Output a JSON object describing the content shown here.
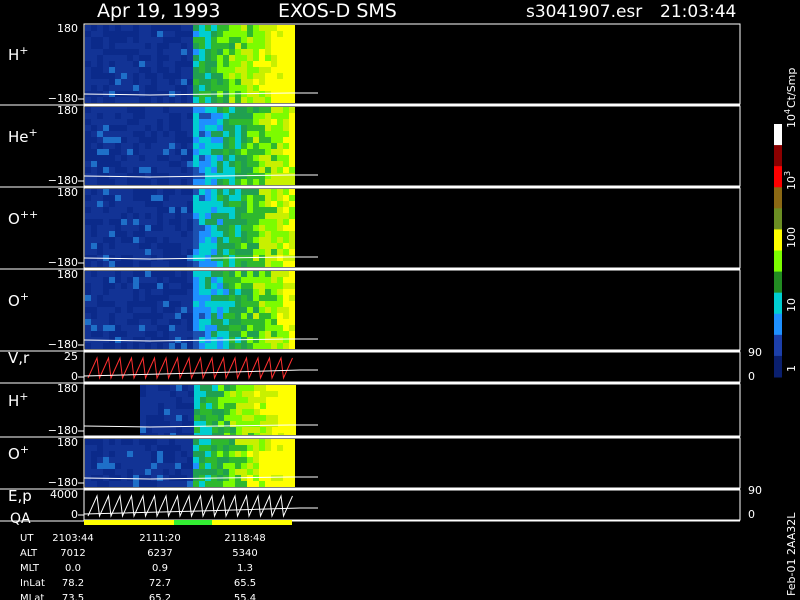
{
  "header": {
    "date": "Apr 19, 1993",
    "instrument": "EXOS-D SMS",
    "file": "s3041907.esr",
    "time": "21:03:44"
  },
  "panels": [
    {
      "id": "h-plus-1",
      "label": "H",
      "sup": "+",
      "ytop": "180",
      "ybot": "−180"
    },
    {
      "id": "he-plus",
      "label": "He",
      "sup": "+",
      "ytop": "180",
      "ybot": "−180"
    },
    {
      "id": "o-plus-plus",
      "label": "O",
      "sup": "++",
      "ytop": "180",
      "ybot": "−180"
    },
    {
      "id": "o-plus-1",
      "label": "O",
      "sup": "+",
      "ytop": "180",
      "ybot": "−180"
    },
    {
      "id": "v-r",
      "label": "V,r",
      "sup": "",
      "ytop": "25",
      "ybot": "0",
      "right_top": "90",
      "right_bot": "0"
    },
    {
      "id": "h-plus-2",
      "label": "H",
      "sup": "+",
      "ytop": "180",
      "ybot": "−180"
    },
    {
      "id": "o-plus-2",
      "label": "O",
      "sup": "+",
      "ytop": "180",
      "ybot": "−180"
    },
    {
      "id": "e-p",
      "label": "E,p",
      "sup": "",
      "ytop": "4000",
      "ybot": "0",
      "right_top": "90",
      "right_bot": "0"
    }
  ],
  "qa_label": "QA",
  "colorbar": {
    "unit": "Ct/Smp",
    "labels": [
      {
        "base": "10",
        "exp": "4"
      },
      {
        "base": "10",
        "exp": "3"
      },
      {
        "base": "100",
        "exp": ""
      },
      {
        "base": "10",
        "exp": ""
      },
      {
        "base": "1",
        "exp": ""
      }
    ],
    "colors": [
      "#ffffff",
      "#8b0000",
      "#ff0000",
      "#8b6914",
      "#6b8e23",
      "#ffff00",
      "#7cfc00",
      "#228b22",
      "#00ced1",
      "#1e90ff",
      "#1c3faa",
      "#0a1f6e"
    ]
  },
  "footer": {
    "rows": [
      {
        "label": "UT",
        "values": [
          "2103:44",
          "2111:20",
          "2118:48"
        ]
      },
      {
        "label": "ALT",
        "values": [
          "7012",
          "6237",
          "5340"
        ]
      },
      {
        "label": "MLT",
        "values": [
          "0.0",
          "0.9",
          "1.3"
        ]
      },
      {
        "label": "InLat",
        "values": [
          "78.2",
          "72.7",
          "65.5"
        ]
      },
      {
        "label": "MLat",
        "values": [
          "73.5",
          "65.2",
          "55.4"
        ]
      }
    ]
  },
  "side_label": "Feb-01 2AA32L",
  "chart_data": {
    "type": "heatmap",
    "title": "Apr 19, 1993   EXOS-D SMS",
    "x": [
      "2103:44",
      "2111:20",
      "2118:48"
    ],
    "panels": [
      "H+",
      "He+",
      "O++",
      "O+",
      "V,r",
      "H+",
      "O+",
      "E,p"
    ],
    "angle_range": [
      -180,
      180
    ],
    "colorbar_ticks": [
      "1",
      "10",
      "100",
      "10^3",
      "10^4"
    ],
    "colorbar_unit": "Ct/Smp"
  }
}
